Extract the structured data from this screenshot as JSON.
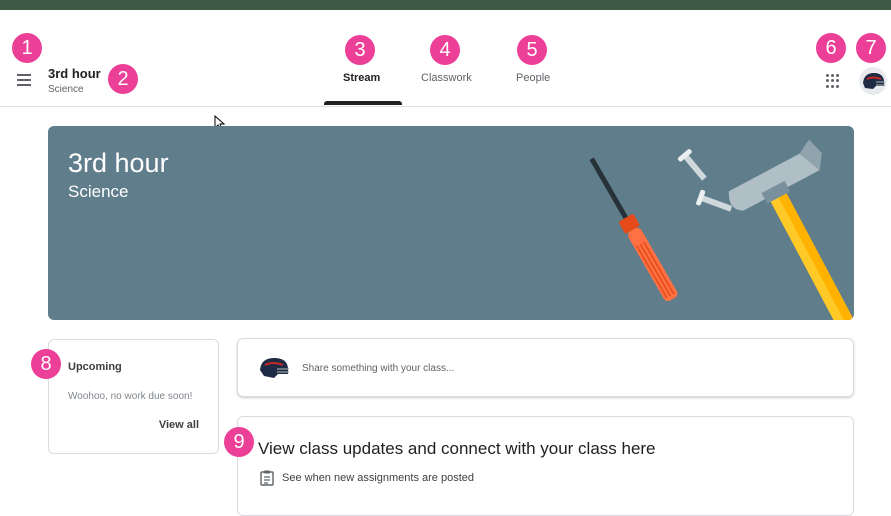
{
  "header": {
    "class_name": "3rd hour",
    "class_subject": "Science",
    "tabs": [
      {
        "label": "Stream",
        "active": true
      },
      {
        "label": "Classwork",
        "active": false
      },
      {
        "label": "People",
        "active": false
      }
    ],
    "icons": {
      "menu": "hamburger-menu-icon",
      "apps": "google-apps-grid-icon",
      "avatar": "user-avatar"
    }
  },
  "banner": {
    "title": "3rd hour",
    "subtitle": "Science",
    "color": "#607d8b",
    "illustration": "tools-screwdriver-hammer-screws"
  },
  "upcoming": {
    "title": "Upcoming",
    "empty_text": "Woohoo, no work due soon!",
    "view_all": "View all"
  },
  "share": {
    "placeholder": "Share something with your class..."
  },
  "info_card": {
    "title": "View class updates and connect with your class here",
    "item": "See when new assignments are posted",
    "item_icon": "assignment-icon"
  },
  "annotations": [
    "1",
    "2",
    "3",
    "4",
    "5",
    "6",
    "7",
    "8",
    "9"
  ],
  "colors": {
    "top_strip": "#3e5a44",
    "badge": "#ec3f97",
    "banner": "#607d8b"
  }
}
